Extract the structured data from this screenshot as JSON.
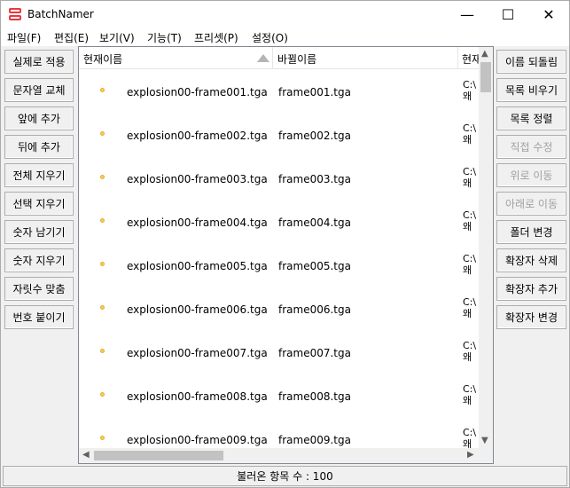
{
  "window": {
    "title": "BatchNamer",
    "minimize_glyph": "—",
    "maximize_glyph": "☐",
    "close_glyph": "✕"
  },
  "menu": [
    "파일(F)",
    "편집(E)",
    "보기(V)",
    "기능(T)",
    "프리셋(P)",
    "설정(O)"
  ],
  "left_buttons": [
    {
      "label": "실제로 적용",
      "enabled": true
    },
    {
      "label": "문자열 교체",
      "enabled": true
    },
    {
      "label": "앞에 추가",
      "enabled": true
    },
    {
      "label": "뒤에 추가",
      "enabled": true
    },
    {
      "label": "전체 지우기",
      "enabled": true
    },
    {
      "label": "선택 지우기",
      "enabled": true
    },
    {
      "label": "숫자 남기기",
      "enabled": true
    },
    {
      "label": "숫자 지우기",
      "enabled": true
    },
    {
      "label": "자릿수 맞춤",
      "enabled": true
    },
    {
      "label": "번호 붙이기",
      "enabled": true
    }
  ],
  "right_buttons": [
    {
      "label": "이름 되돌림",
      "enabled": true
    },
    {
      "label": "목록 비우기",
      "enabled": true
    },
    {
      "label": "목록 정렬",
      "enabled": true
    },
    {
      "label": "직접 수정",
      "enabled": false
    },
    {
      "label": "위로 이동",
      "enabled": false
    },
    {
      "label": "아래로 이동",
      "enabled": false
    },
    {
      "label": "폴더 변경",
      "enabled": true
    },
    {
      "label": "확장자 삭제",
      "enabled": true
    },
    {
      "label": "확장자 추가",
      "enabled": true
    },
    {
      "label": "확장자 변경",
      "enabled": true
    }
  ],
  "list": {
    "columns": {
      "current": "현재이름",
      "new": "바뀔이름",
      "path": "현재"
    },
    "rows": [
      {
        "current": "explosion00-frame001.tga",
        "new": "frame001.tga",
        "path1": "C:\\",
        "path2": "왜"
      },
      {
        "current": "explosion00-frame002.tga",
        "new": "frame002.tga",
        "path1": "C:\\",
        "path2": "왜"
      },
      {
        "current": "explosion00-frame003.tga",
        "new": "frame003.tga",
        "path1": "C:\\",
        "path2": "왜"
      },
      {
        "current": "explosion00-frame004.tga",
        "new": "frame004.tga",
        "path1": "C:\\",
        "path2": "왜"
      },
      {
        "current": "explosion00-frame005.tga",
        "new": "frame005.tga",
        "path1": "C:\\",
        "path2": "왜"
      },
      {
        "current": "explosion00-frame006.tga",
        "new": "frame006.tga",
        "path1": "C:\\",
        "path2": "왜"
      },
      {
        "current": "explosion00-frame007.tga",
        "new": "frame007.tga",
        "path1": "C:\\",
        "path2": "왜"
      },
      {
        "current": "explosion00-frame008.tga",
        "new": "frame008.tga",
        "path1": "C:\\",
        "path2": "왜"
      },
      {
        "current": "explosion00-frame009.tga",
        "new": "frame009.tga",
        "path1": "C:\\",
        "path2": "왜"
      }
    ]
  },
  "status": "불러온 항목 수 : 100"
}
